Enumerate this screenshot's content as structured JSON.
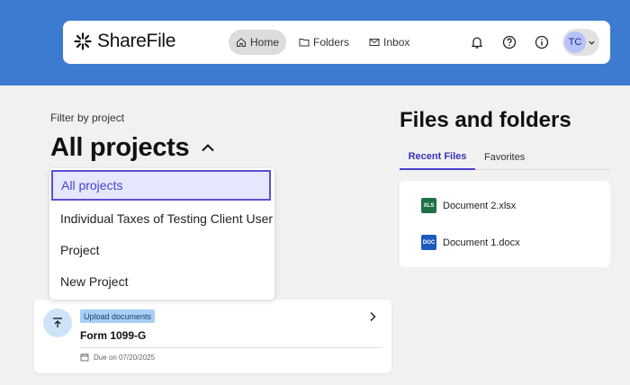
{
  "header": {
    "app_name": "ShareFile",
    "nav": [
      {
        "label": "Home",
        "icon": "home-icon",
        "active": true
      },
      {
        "label": "Folders",
        "icon": "folder-icon",
        "active": false
      },
      {
        "label": "Inbox",
        "icon": "mail-icon",
        "active": false
      }
    ],
    "icons": [
      "bell-icon",
      "help-icon",
      "info-icon"
    ],
    "user_initials": "TC"
  },
  "filter": {
    "label": "Filter by project",
    "selected": "All projects",
    "options": [
      "All projects",
      "Individual Taxes of Testing Client User",
      "Project",
      "New Project"
    ]
  },
  "task": {
    "badge": "Upload documents",
    "name": "Form 1099-G",
    "due": "Due on 07/20/2025"
  },
  "files": {
    "title": "Files and folders",
    "tabs": [
      "Recent Files",
      "Favorites"
    ],
    "items": [
      {
        "type": "XLS",
        "name": "Document 2.xlsx",
        "color": "#1e7145"
      },
      {
        "type": "DOC",
        "name": "Document 1.docx",
        "color": "#1d5bbf"
      }
    ]
  },
  "colors": {
    "brand_blue": "#3d7bd1",
    "accent_purple": "#4b3fd1",
    "selected_bg": "#e5e8ff"
  }
}
